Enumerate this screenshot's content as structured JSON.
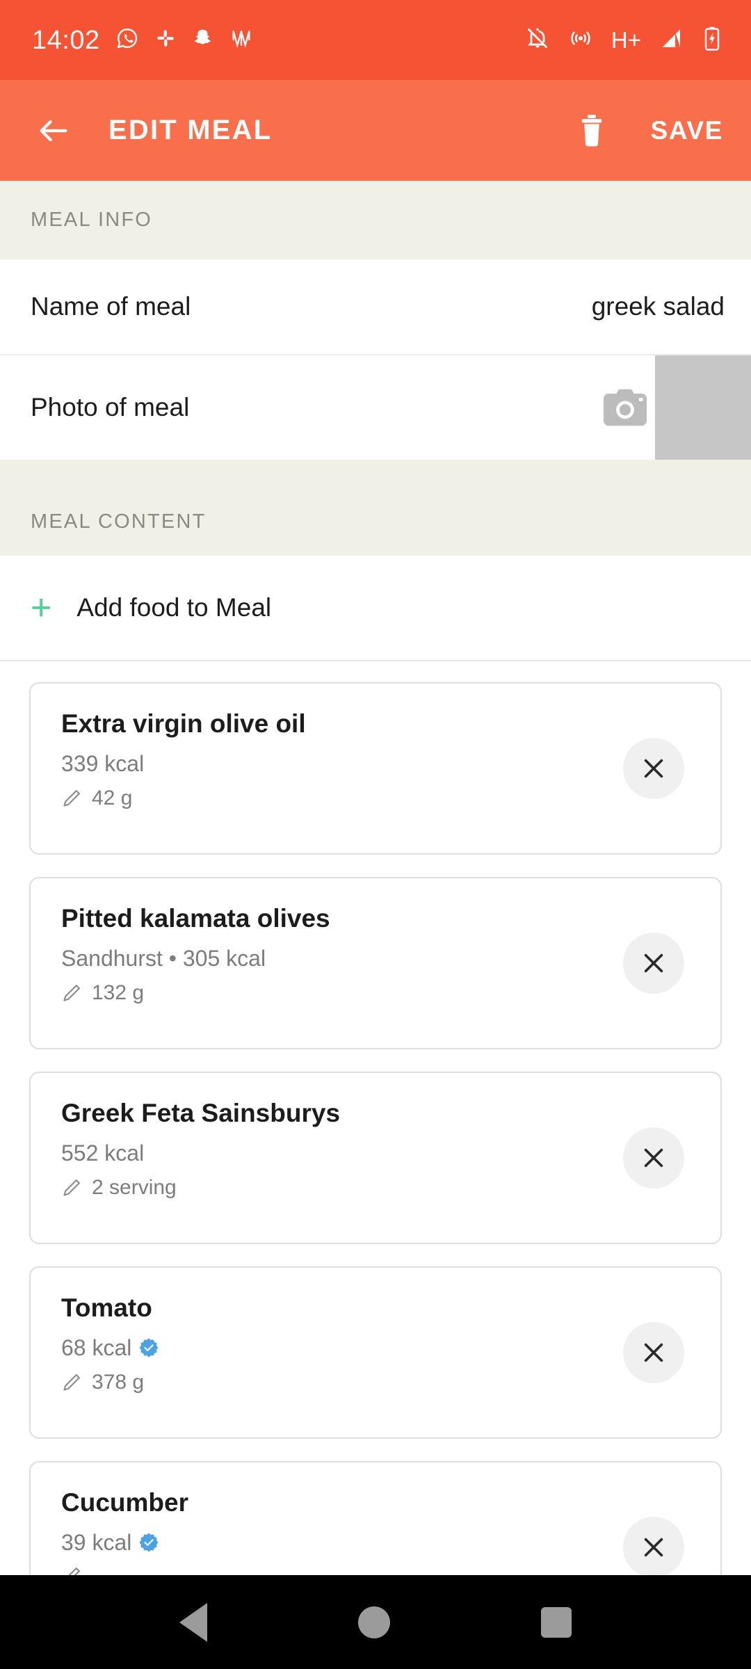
{
  "status_bar": {
    "time": "14:02",
    "left_icons": [
      "whatsapp-icon",
      "slack-icon",
      "snapchat-icon",
      "w-app-icon"
    ],
    "right_icons": [
      "notifications-muted-icon",
      "hotspot-icon",
      "network-hplus-icon",
      "signal-icon",
      "battery-charging-icon"
    ],
    "network_label": "H+",
    "background": "#F55334"
  },
  "app_bar": {
    "title": "EDIT MEAL",
    "back_label": "back-arrow",
    "delete_label": "delete",
    "save_label": "SAVE",
    "background": "#F96F4C"
  },
  "meal_info": {
    "section_title": "MEAL INFO",
    "name_label": "Name of meal",
    "name_value": "greek salad",
    "photo_label": "Photo of meal",
    "photo_placeholder_color": "#C6C6C6"
  },
  "meal_content": {
    "section_title": "MEAL CONTENT",
    "add_food_label": "Add food to Meal",
    "add_icon_color": "#4CD196",
    "foods": [
      {
        "name": "Extra virgin olive oil",
        "brand": "",
        "calories": "339 kcal",
        "subtitle": "339 kcal",
        "quantity": "42 g",
        "verified": false,
        "remove_label": "remove"
      },
      {
        "name": "Pitted kalamata olives",
        "brand": "Sandhurst",
        "calories": "305 kcal",
        "subtitle": "Sandhurst • 305 kcal",
        "quantity": "132 g",
        "verified": false,
        "remove_label": "remove"
      },
      {
        "name": "Greek Feta Sainsburys",
        "brand": "",
        "calories": "552 kcal",
        "subtitle": "552 kcal",
        "quantity": "2 serving",
        "verified": false,
        "remove_label": "remove"
      },
      {
        "name": "Tomato",
        "brand": "",
        "calories": "68 kcal",
        "subtitle": "68 kcal",
        "quantity": "378 g",
        "verified": true,
        "remove_label": "remove"
      },
      {
        "name": "Cucumber",
        "brand": "",
        "calories": "39 kcal",
        "subtitle": "39 kcal",
        "quantity": "",
        "verified": true,
        "remove_label": "remove"
      }
    ],
    "verified_badge_color": "#4BA3E3"
  },
  "nav_bar": {
    "back_label": "back",
    "home_label": "home",
    "recents_label": "recent-apps",
    "background": "#000000"
  }
}
